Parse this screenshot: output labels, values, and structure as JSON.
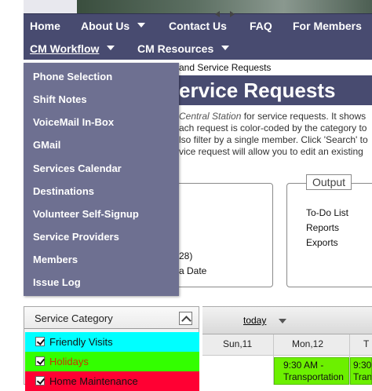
{
  "nav": {
    "row1": [
      {
        "label": "Home",
        "caret": false
      },
      {
        "label": "About Us",
        "caret": true
      },
      {
        "label": "Contact Us",
        "caret": false
      },
      {
        "label": "FAQ",
        "caret": false
      },
      {
        "label": "For Members",
        "caret": false
      }
    ],
    "row2": [
      {
        "label": "CM Workflow",
        "caret": true,
        "active": true
      },
      {
        "label": "CM Resources",
        "caret": true,
        "active": false
      }
    ]
  },
  "dropdown": {
    "items": [
      "Phone Selection",
      "Shift Notes",
      "VoiceMail In-Box",
      "GMail",
      "Services Calendar",
      "Destinations",
      "Volunteer Self-Signup",
      "Service Providers",
      "Members",
      "Issue Log"
    ]
  },
  "page": {
    "breadcrumb": "and Service Requests",
    "title": "ervice Requests",
    "intro_lead": "Central Station",
    "intro_lead_rest": " for service requests. It shows",
    "intro_lines": [
      "ach request is color-coded by the category to",
      "lso filter by a single member. Click 'Search' to",
      "vice request will allow you to edit an existing"
    ]
  },
  "left_box": {
    "lines": [
      "28)",
      "a Date"
    ]
  },
  "output": {
    "legend": "Output",
    "links": [
      "To-Do List",
      "Reports",
      "Exports"
    ]
  },
  "service_category": {
    "title": "Service Category",
    "rows": [
      {
        "label": "Friendly Visits",
        "bg": "#00ffff",
        "color": "#111111",
        "checked": true
      },
      {
        "label": "Holidays",
        "bg": "#33ff00",
        "color": "#cc3300",
        "checked": true
      },
      {
        "label": "Home Maintenance",
        "bg": "#ff0033",
        "color": "#111111",
        "checked": true
      }
    ]
  },
  "calendar": {
    "today_label": "today",
    "days": [
      "Sun,11",
      "Mon,12",
      "T"
    ],
    "events": [
      {
        "time": "9:30 AM -",
        "title": "Transportation"
      },
      {
        "time": "9:30",
        "title": "Tran"
      }
    ],
    "event_color": "#6cf000"
  }
}
